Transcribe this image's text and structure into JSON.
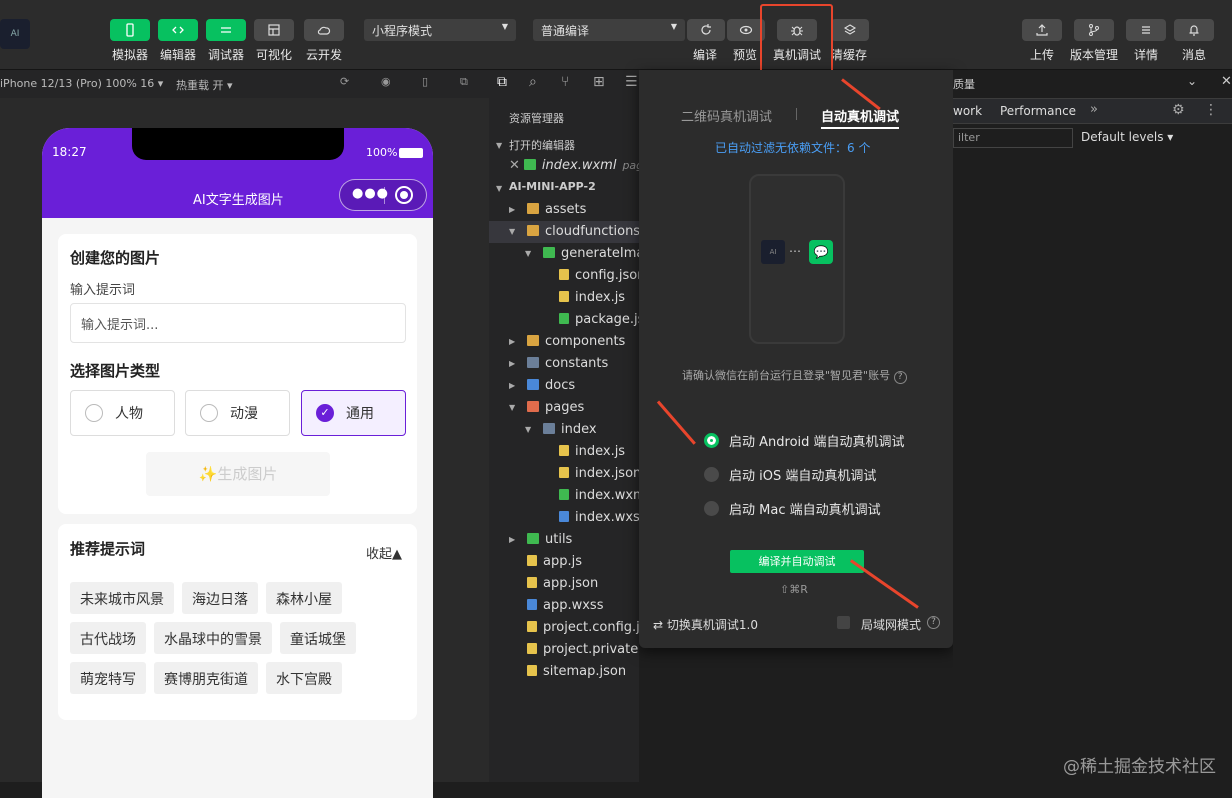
{
  "toolbar": {
    "left_buttons": [
      "模拟器",
      "编辑器",
      "调试器",
      "可视化",
      "云开发"
    ],
    "mode_select": "小程序模式",
    "compile_select": "普通编译",
    "right_actions": [
      "编译",
      "预览",
      "真机调试",
      "清缓存"
    ],
    "far_right": [
      "上传",
      "版本管理",
      "详情",
      "消息"
    ],
    "logo_text": "AI"
  },
  "subbar": {
    "device": "iPhone 12/13 (Pro) 100% 16 ▾",
    "hotreload": "热重载 开 ▾"
  },
  "phone": {
    "time": "18:27",
    "battery": "100%",
    "title": "AI文字生成图片",
    "create_title": "创建您的图片",
    "prompt_label": "输入提示词",
    "prompt_placeholder": "输入提示词...",
    "type_title": "选择图片类型",
    "types": [
      "人物",
      "动漫",
      "通用"
    ],
    "generate_label": "✨生成图片",
    "rec_title": "推荐提示词",
    "collapse": "收起▲",
    "tags": [
      "未来城市风景",
      "海边日落",
      "森林小屋",
      "古代战场",
      "水晶球中的雪景",
      "童话城堡",
      "萌宠特写",
      "赛博朋克街道",
      "水下宫殿"
    ]
  },
  "explorer": {
    "title": "资源管理器",
    "open_editors": "打开的编辑器",
    "open_file": "index.wxml",
    "open_file_hint": "pag",
    "project": "AI-MINI-APP-2",
    "items": [
      "assets",
      "cloudfunctions",
      "generateImage",
      "config.json",
      "index.js",
      "package.json",
      "components",
      "constants",
      "docs",
      "pages",
      "index",
      "index.js",
      "index.json",
      "index.wxml",
      "index.wxss",
      "utils",
      "app.js",
      "app.json",
      "app.wxss",
      "project.config.js",
      "project.private.config...",
      "sitemap.json"
    ]
  },
  "popup": {
    "tab1": "二维码真机调试",
    "tab2": "自动真机调试",
    "filter_note": "已自动过滤无依赖文件：6 个",
    "confirm": "请确认微信在前台运行且登录\"智见君\"账号",
    "options": [
      "启动 Android 端自动真机调试",
      "启动 iOS 端自动真机调试",
      "启动 Mac 端自动真机调试"
    ],
    "compile_btn": "编译并自动调试",
    "shortcut": "⇧⌘R",
    "switch": "切换真机调试1.0",
    "lan": "局域网模式"
  },
  "devtools": {
    "title": "质量",
    "tab_network": "work",
    "tab_perf": "Performance",
    "filter": "ilter",
    "levels": "Default levels ▾"
  },
  "watermark": "@稀土掘金技术社区",
  "colors": {
    "accent_green": "#07c160",
    "brand_purple": "#6a1fd8",
    "arrow_red": "#e8452c"
  }
}
